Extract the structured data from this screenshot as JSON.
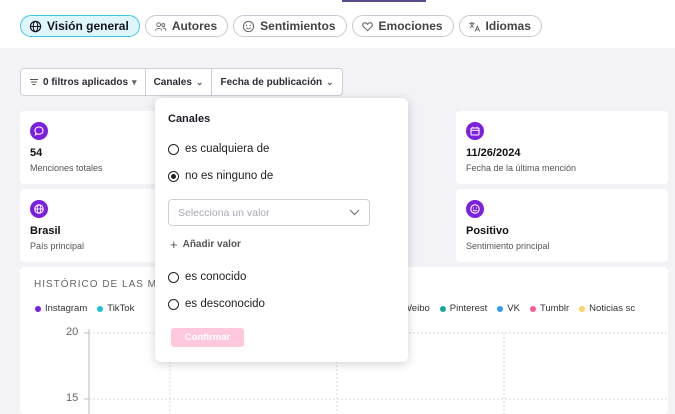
{
  "tabs": [
    {
      "label": "Visión general",
      "icon": "globe-icon",
      "active": true
    },
    {
      "label": "Autores",
      "icon": "users-icon",
      "active": false
    },
    {
      "label": "Sentimientos",
      "icon": "smile-icon",
      "active": false
    },
    {
      "label": "Emociones",
      "icon": "heart-icon",
      "active": false
    },
    {
      "label": "Idiomas",
      "icon": "translate-icon",
      "active": false
    }
  ],
  "filters": {
    "applied": "0 filtros aplicados",
    "channels": "Canales",
    "date": "Fecha de publicación"
  },
  "cards": [
    {
      "value": "54",
      "label": "Menciones totales",
      "icon": "chat-icon"
    },
    {
      "value": "11/26/2024",
      "label": "Fecha de la última mención",
      "icon": "calendar-icon"
    },
    {
      "value": "Brasil",
      "label": "País principal",
      "icon": "globe-icon"
    },
    {
      "value": "Positivo",
      "label": "Sentimiento principal",
      "icon": "smile-icon"
    }
  ],
  "chart": {
    "title": "HISTÓRICO DE LAS M",
    "legend_left": [
      {
        "name": "Instagram",
        "color": "#7b1fe0"
      },
      {
        "name": "TikTok",
        "color": "#19c2d6"
      }
    ],
    "legend_right": [
      {
        "name": "Weibo",
        "color": "#e4414f"
      },
      {
        "name": "Pinterest",
        "color": "#14a89c"
      },
      {
        "name": "VK",
        "color": "#2a9df4"
      },
      {
        "name": "Tumblr",
        "color": "#ff5d8f"
      },
      {
        "name": "Noticias sc",
        "color": "#ffd166"
      }
    ],
    "yticks": [
      "20",
      "15"
    ]
  },
  "panel": {
    "title": "Canales",
    "options": [
      {
        "label": "es cualquiera de",
        "selected": false
      },
      {
        "label": "no es ninguno de",
        "selected": true
      },
      {
        "label": "es conocido",
        "selected": false
      },
      {
        "label": "es desconocido",
        "selected": false
      }
    ],
    "select_placeholder": "Selecciona un valor",
    "add_value": "Añadir valor",
    "confirm": "Confirmar"
  }
}
